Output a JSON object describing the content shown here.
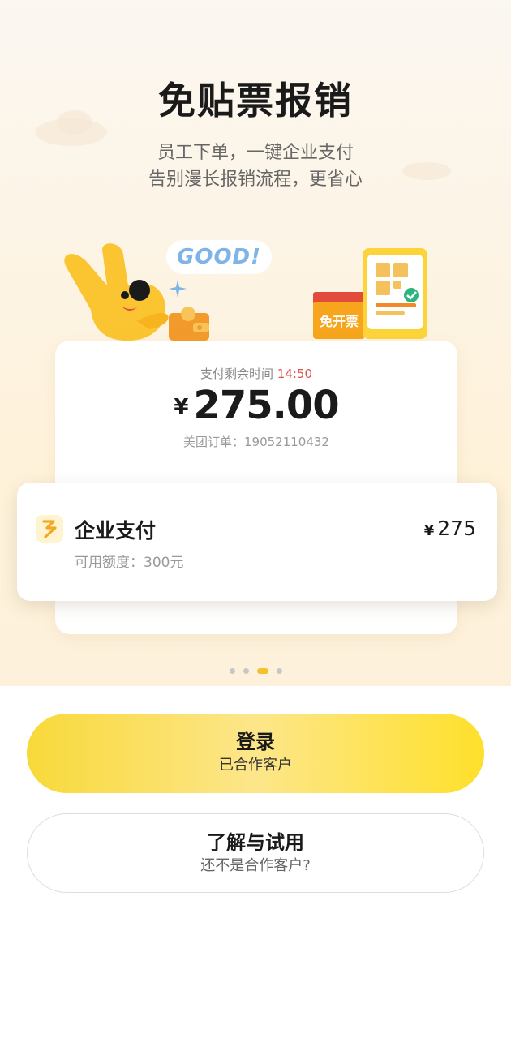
{
  "hero": {
    "title": "免贴票报销",
    "subtitle_line1": "员工下单，一键企业支付",
    "subtitle_line2": "告别漫长报销流程，更省心"
  },
  "illustration": {
    "bubble_text": "GOOD!",
    "gift_label": "免开票"
  },
  "order": {
    "pay_time_label": "支付剩余时间",
    "pay_time_value": "14:50",
    "currency": "¥",
    "amount": "275.00",
    "order_no": "美团订单：19052110432"
  },
  "enterprise_pay": {
    "name": "企业支付",
    "currency": "¥",
    "amount": "275",
    "quota": "可用额度：300元"
  },
  "carousel": {
    "total": 4,
    "active_index": 2
  },
  "buttons": {
    "login": {
      "label": "登录",
      "sublabel": "已合作客户"
    },
    "learn": {
      "label": "了解与试用",
      "sublabel": "还不是合作客户?"
    }
  },
  "colors": {
    "accent_yellow": "#fee02b",
    "countdown_red": "#e0504a",
    "dot_active": "#f6c02c"
  }
}
